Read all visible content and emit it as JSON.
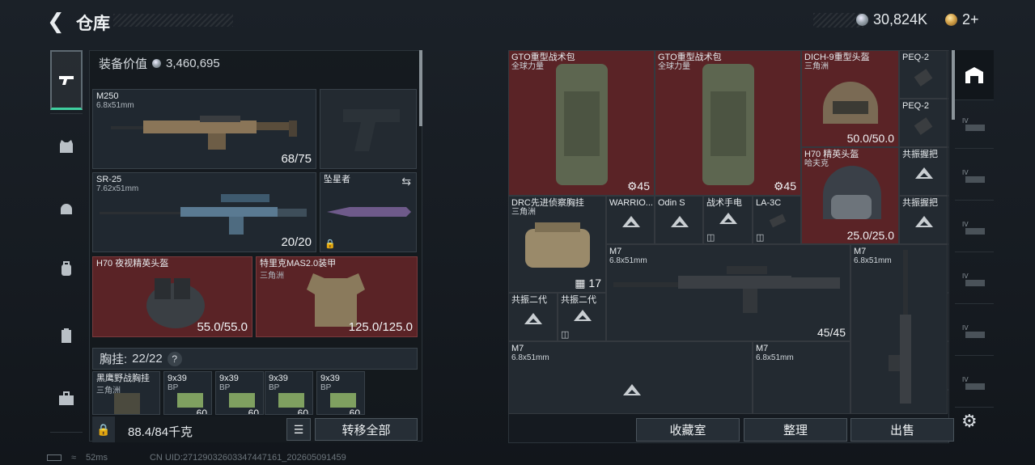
{
  "header": {
    "title": "仓库",
    "currency": "30,824K",
    "tokens": "2+"
  },
  "equipment_value": {
    "label": "装备价值",
    "value": "3,460,695"
  },
  "loadout": {
    "primary": {
      "name": "M250",
      "caliber": "6.8x51mm",
      "ammo": "68/75"
    },
    "secondary": {
      "name": "SR-25",
      "caliber": "7.62x51mm",
      "ammo": "20/20"
    },
    "melee": {
      "name": "坠星者"
    },
    "helmet": {
      "name": "H70 夜视精英头盔",
      "durability": "55.0/55.0"
    },
    "armor": {
      "name": "特里克MAS2.0装甲",
      "region": "三角洲",
      "durability": "125.0/125.0"
    },
    "rig": {
      "label": "胸挂:",
      "count": "22/22",
      "help": "?"
    },
    "rig_items": [
      {
        "name": "黑鹰野战胸挂",
        "sub": "三角洲"
      },
      {
        "name": "9x39",
        "sub": "BP",
        "count": "60"
      },
      {
        "name": "9x39",
        "sub": "BP",
        "count": "60"
      },
      {
        "name": "9x39",
        "sub": "BP",
        "count": "60"
      },
      {
        "name": "9x39",
        "sub": "BP",
        "count": "60"
      }
    ],
    "weight": "88.4/84千克",
    "transfer_all": "转移全部"
  },
  "stash": [
    {
      "name": "GTO重型战术包",
      "sub": "全球力量",
      "count": "45"
    },
    {
      "name": "GTO重型战术包",
      "sub": "全球力量",
      "count": "45"
    },
    {
      "name": "DICH-9重型头盔",
      "sub": "三角洲",
      "count": "50.0/50.0"
    },
    {
      "name": "PEQ-2"
    },
    {
      "name": "PEQ-2"
    },
    {
      "name": "H70 精英头盔",
      "sub": "哈夫克",
      "count": "25.0/25.0"
    },
    {
      "name": "共振握把"
    },
    {
      "name": "共振握把"
    },
    {
      "name": "DRC先进侦察胸挂",
      "sub": "三角洲",
      "count": "17"
    },
    {
      "name": "WARRIO..."
    },
    {
      "name": "Odin S"
    },
    {
      "name": "战术手电"
    },
    {
      "name": "LA-3C"
    },
    {
      "name": "M7",
      "sub": "6.8x51mm",
      "count": "45/45"
    },
    {
      "name": "M7",
      "sub": "6.8x51mm"
    },
    {
      "name": "共振二代"
    },
    {
      "name": "共振二代"
    },
    {
      "name": "M7",
      "sub": "6.8x51mm"
    },
    {
      "name": "M7",
      "sub": "6.8x51mm"
    }
  ],
  "actions": {
    "collection": "收藏室",
    "sort": "整理",
    "sell": "出售"
  },
  "status": {
    "ping": "52ms",
    "uid": "CN UID:27129032603347447161_202605091459"
  }
}
